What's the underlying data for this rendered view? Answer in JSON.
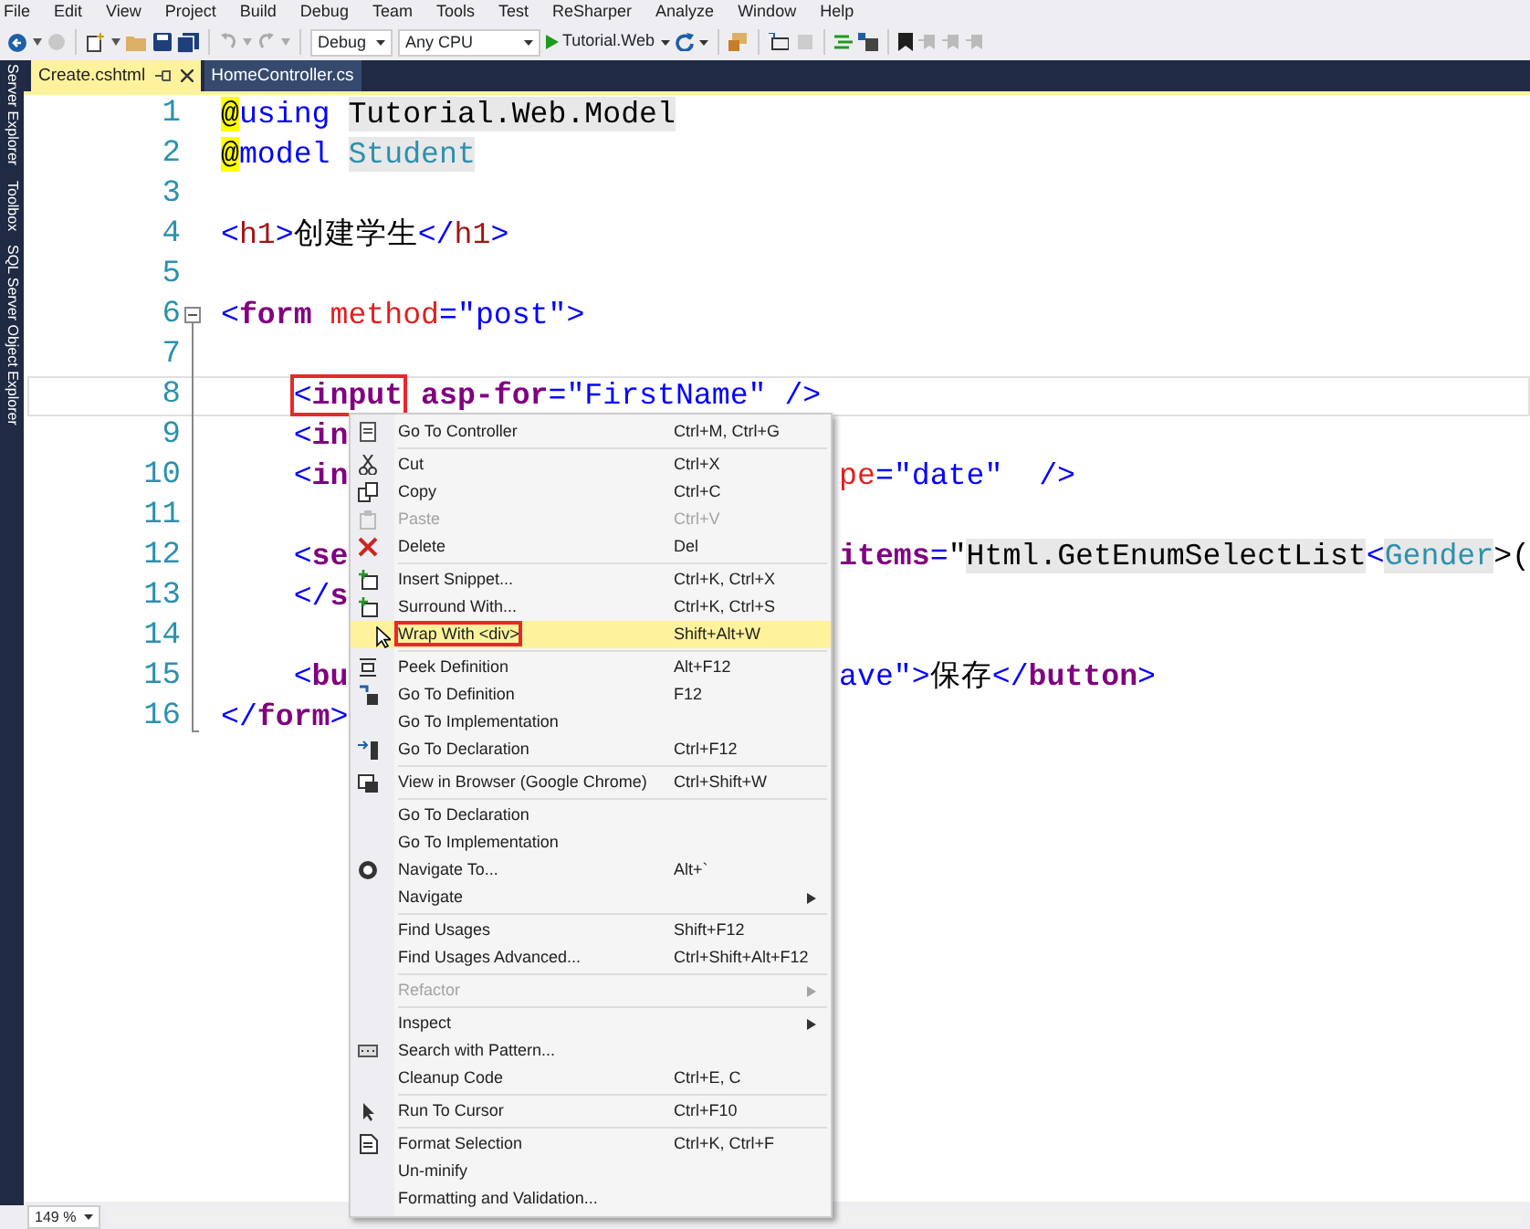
{
  "menu_bar": [
    "File",
    "Edit",
    "View",
    "Project",
    "Build",
    "Debug",
    "Team",
    "Tools",
    "Test",
    "ReSharper",
    "Analyze",
    "Window",
    "Help"
  ],
  "toolbar": {
    "configuration": "Debug",
    "platform": "Any CPU",
    "start_target": "Tutorial.Web"
  },
  "side_panels": [
    "Server Explorer",
    "Toolbox",
    "SQL Server Object Explorer"
  ],
  "tabs": [
    {
      "label": "Create.cshtml",
      "selected": true
    },
    {
      "label": "HomeController.cs",
      "selected": false
    }
  ],
  "editor": {
    "lines": [
      {
        "number": "1",
        "current": false,
        "tokens": [
          {
            "text": "@",
            "kind": "razor"
          },
          {
            "text": "using ",
            "kind": "keyword"
          },
          {
            "text": "Tutorial.Web.Model",
            "kind": "ns"
          }
        ]
      },
      {
        "number": "2",
        "current": false,
        "tokens": [
          {
            "text": "@",
            "kind": "razor"
          },
          {
            "text": "model ",
            "kind": "keyword"
          },
          {
            "text": "Student",
            "kind": "type"
          }
        ]
      },
      {
        "number": "3",
        "current": false
      },
      {
        "number": "4",
        "current": false,
        "tokens": [
          {
            "text": "<",
            "kind": "punct"
          },
          {
            "text": "h1",
            "kind": "tagname"
          },
          {
            "text": ">",
            "kind": "punct"
          },
          {
            "text": "创建学生",
            "kind": "plain"
          },
          {
            "text": "</",
            "kind": "punct"
          },
          {
            "text": "h1",
            "kind": "tagname"
          },
          {
            "text": ">",
            "kind": "punct"
          }
        ]
      },
      {
        "number": "5",
        "current": false
      },
      {
        "number": "6",
        "current": false,
        "tokens": [
          {
            "text": "<",
            "kind": "punct"
          },
          {
            "text": "form",
            "kind": "tag"
          },
          {
            "text": " method",
            "kind": "attr"
          },
          {
            "text": "=",
            "kind": "punct"
          },
          {
            "text": "\"post\"",
            "kind": "string"
          },
          {
            "text": ">",
            "kind": "punct"
          }
        ],
        "children": [
          {
            "number": "7",
            "current": false
          },
          {
            "number": "8",
            "current": true,
            "tokens": [
              {
                "text": "<input",
                "kind": "tag-open",
                "boxed": true
              },
              {
                "text": " asp-for",
                "kind": "tag"
              },
              {
                "text": "=",
                "kind": "punct"
              },
              {
                "text": "\"FirstName\"",
                "kind": "string"
              },
              {
                "text": " />",
                "kind": "punct"
              }
            ]
          },
          {
            "number": "9",
            "current": false,
            "tokens": [
              {
                "text": "<in",
                "kind": "tag-open"
              }
            ]
          },
          {
            "number": "10",
            "current": false,
            "tokens": [
              {
                "text": "<in",
                "kind": "tag-open"
              }
            ],
            "tail": [
              {
                "text": "pe",
                "kind": "attr"
              },
              {
                "text": "=",
                "kind": "punct"
              },
              {
                "text": "\"date\"",
                "kind": "string"
              },
              {
                "text": "  />",
                "kind": "punct"
              }
            ]
          },
          {
            "number": "11",
            "current": false
          },
          {
            "number": "12",
            "current": false,
            "tokens": [
              {
                "text": "<se",
                "kind": "tag-open"
              }
            ],
            "tail": [
              {
                "text": "items",
                "kind": "tag"
              },
              {
                "text": "=",
                "kind": "punct"
              },
              {
                "text": "\"",
                "kind": "plain"
              },
              {
                "text": "Html.GetEnumSelectList",
                "kind": "ns"
              },
              {
                "text": "<",
                "kind": "punct"
              },
              {
                "text": "Gender",
                "kind": "type"
              },
              {
                "text": ">(",
                "kind": "plain"
              }
            ]
          },
          {
            "number": "13",
            "current": false,
            "tokens": [
              {
                "text": "</s",
                "kind": "tag-close"
              }
            ]
          },
          {
            "number": "14",
            "current": false
          },
          {
            "number": "15",
            "current": false,
            "tokens": [
              {
                "text": "<bu",
                "kind": "tag-open"
              }
            ],
            "tail": [
              {
                "text": "ave\"",
                "kind": "string"
              },
              {
                "text": ">",
                "kind": "punct"
              },
              {
                "text": "保存",
                "kind": "plain"
              },
              {
                "text": "</",
                "kind": "punct"
              },
              {
                "text": "button",
                "kind": "tag"
              },
              {
                "text": ">",
                "kind": "punct"
              }
            ]
          }
        ]
      },
      {
        "number": "16",
        "current": false,
        "tokens": [
          {
            "text": "</",
            "kind": "punct"
          },
          {
            "text": "form",
            "kind": "tag"
          },
          {
            "text": ">",
            "kind": "punct"
          }
        ]
      }
    ]
  },
  "context_menu": {
    "groups": [
      {
        "items": [
          {
            "label": "Go To Controller",
            "shortcut": "Ctrl+M, Ctrl+G",
            "disabled": false,
            "submenu": false,
            "hovered": false,
            "boxed": false
          }
        ]
      },
      {
        "items": [
          {
            "label": "Cut",
            "shortcut": "Ctrl+X",
            "disabled": false,
            "submenu": false,
            "hovered": false,
            "boxed": false
          },
          {
            "label": "Copy",
            "shortcut": "Ctrl+C",
            "disabled": false,
            "submenu": false,
            "hovered": false,
            "boxed": false
          },
          {
            "label": "Paste",
            "shortcut": "Ctrl+V",
            "disabled": true,
            "submenu": false,
            "hovered": false,
            "boxed": false
          },
          {
            "label": "Delete",
            "shortcut": "Del",
            "disabled": false,
            "submenu": false,
            "hovered": false,
            "boxed": false
          }
        ]
      },
      {
        "items": [
          {
            "label": "Insert Snippet...",
            "shortcut": "Ctrl+K, Ctrl+X",
            "disabled": false,
            "submenu": false,
            "hovered": false,
            "boxed": false
          },
          {
            "label": "Surround With...",
            "shortcut": "Ctrl+K, Ctrl+S",
            "disabled": false,
            "submenu": false,
            "hovered": false,
            "boxed": false
          },
          {
            "label": "Wrap With <div>",
            "shortcut": "Shift+Alt+W",
            "disabled": false,
            "submenu": false,
            "hovered": true,
            "boxed": true
          }
        ]
      },
      {
        "items": [
          {
            "label": "Peek Definition",
            "shortcut": "Alt+F12",
            "disabled": false,
            "submenu": false,
            "hovered": false,
            "boxed": false
          },
          {
            "label": "Go To Definition",
            "shortcut": "F12",
            "disabled": false,
            "submenu": false,
            "hovered": false,
            "boxed": false
          },
          {
            "label": "Go To Implementation",
            "disabled": false,
            "submenu": false,
            "hovered": false,
            "boxed": false
          },
          {
            "label": "Go To Declaration",
            "shortcut": "Ctrl+F12",
            "disabled": false,
            "submenu": false,
            "hovered": false,
            "boxed": false
          }
        ]
      },
      {
        "items": [
          {
            "label": "View in Browser (Google Chrome)",
            "shortcut": "Ctrl+Shift+W",
            "disabled": false,
            "submenu": false,
            "hovered": false,
            "boxed": false
          }
        ]
      },
      {
        "items": [
          {
            "label": "Go To Declaration",
            "disabled": false,
            "submenu": false,
            "hovered": false,
            "boxed": false
          },
          {
            "label": "Go To Implementation",
            "disabled": false,
            "submenu": false,
            "hovered": false,
            "boxed": false
          },
          {
            "label": "Navigate To...",
            "shortcut": "Alt+`",
            "disabled": false,
            "submenu": false,
            "hovered": false,
            "boxed": false
          },
          {
            "label": "Navigate",
            "disabled": false,
            "submenu": true,
            "hovered": false,
            "boxed": false
          }
        ]
      },
      {
        "items": [
          {
            "label": "Find Usages",
            "shortcut": "Shift+F12",
            "disabled": false,
            "submenu": false,
            "hovered": false,
            "boxed": false
          },
          {
            "label": "Find Usages Advanced...",
            "shortcut": "Ctrl+Shift+Alt+F12",
            "disabled": false,
            "submenu": false,
            "hovered": false,
            "boxed": false
          }
        ]
      },
      {
        "items": [
          {
            "label": "Refactor",
            "disabled": true,
            "submenu": true,
            "hovered": false,
            "boxed": false
          }
        ]
      },
      {
        "items": [
          {
            "label": "Inspect",
            "disabled": false,
            "submenu": true,
            "hovered": false,
            "boxed": false
          },
          {
            "label": "Search with Pattern...",
            "disabled": false,
            "submenu": false,
            "hovered": false,
            "boxed": false
          },
          {
            "label": "Cleanup Code",
            "shortcut": "Ctrl+E, C",
            "disabled": false,
            "submenu": false,
            "hovered": false,
            "boxed": false
          }
        ]
      },
      {
        "items": [
          {
            "label": "Run To Cursor",
            "shortcut": "Ctrl+F10",
            "disabled": false,
            "submenu": false,
            "hovered": false,
            "boxed": false
          }
        ]
      },
      {
        "items": [
          {
            "label": "Format Selection",
            "shortcut": "Ctrl+K, Ctrl+F",
            "disabled": false,
            "submenu": false,
            "hovered": false,
            "boxed": false
          },
          {
            "label": "Un-minify",
            "disabled": false,
            "submenu": false,
            "hovered": false,
            "boxed": false
          },
          {
            "label": "Formatting and Validation...",
            "disabled": false,
            "submenu": false,
            "hovered": false,
            "boxed": false
          }
        ]
      }
    ]
  },
  "status_bar": {
    "zoom": "149 %"
  }
}
